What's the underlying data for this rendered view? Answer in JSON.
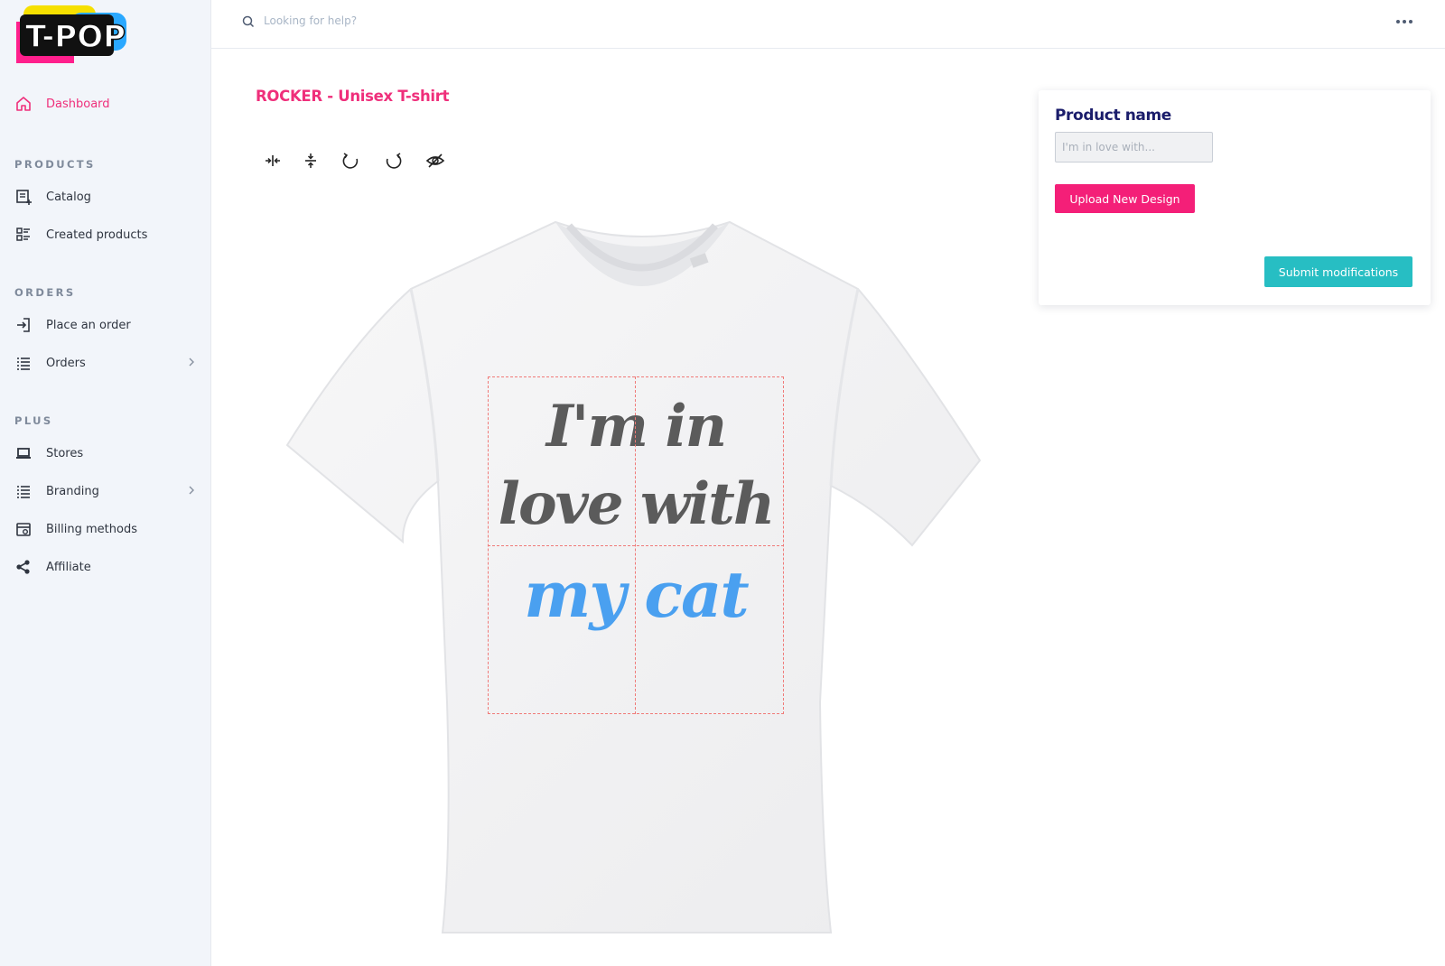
{
  "brand": {
    "logo_text": "T-POP",
    "accent": "#ef2f7b"
  },
  "header": {
    "search_placeholder": "Looking for help?",
    "more_icon": "more-horizontal-icon"
  },
  "sidebar": {
    "dashboard": {
      "label": "Dashboard",
      "icon": "home-icon"
    },
    "sections": {
      "products": "PRODUCTS",
      "orders": "ORDERS",
      "plus": "PLUS"
    },
    "items": {
      "catalog": "Catalog",
      "created_products": "Created products",
      "place_order": "Place an order",
      "orders": "Orders",
      "stores": "Stores",
      "branding": "Branding",
      "billing_methods": "Billing methods",
      "affiliate": "Affiliate"
    }
  },
  "main": {
    "title": "ROCKER - Unisex T-shirt",
    "tools": [
      "align-horizontal-center-icon",
      "align-vertical-center-icon",
      "rotate-left-icon",
      "rotate-right-icon",
      "hide-icon"
    ],
    "design": {
      "line1": "I'm in",
      "line2": "love with",
      "line3": "my cat"
    }
  },
  "panel": {
    "title": "Product name",
    "input_placeholder": "I'm in love with...",
    "upload_label": "Upload New Design",
    "submit_label": "Submit modifications"
  },
  "colors": {
    "upload": "#f41f78",
    "submit": "#27bec3",
    "guides": "#f07a78",
    "title_dark": "#1b1d6b"
  }
}
